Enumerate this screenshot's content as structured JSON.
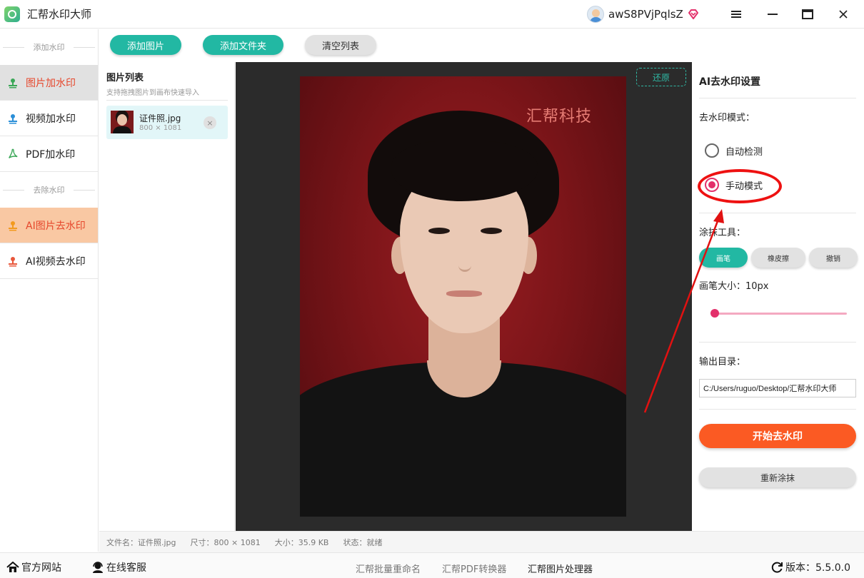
{
  "window": {
    "title": "汇帮水印大师",
    "username": "awS8PVjPqlsZ",
    "menu_icon": "hamburger-menu-icon",
    "minimize_icon": "minimize-icon",
    "maximize_icon": "maximize-icon",
    "close_icon": "close-icon"
  },
  "sidebar": {
    "section_add": "添加水印",
    "section_remove": "去除水印",
    "items": [
      {
        "label": "图片加水印",
        "icon": "image-stamp-icon",
        "active": true
      },
      {
        "label": "视频加水印",
        "icon": "video-stamp-icon",
        "active": false
      },
      {
        "label": "PDF加水印",
        "icon": "pdf-icon",
        "active": false
      },
      {
        "label": "AI图片去水印",
        "icon": "ai-image-stamp-icon",
        "active": true
      },
      {
        "label": "AI视频去水印",
        "icon": "ai-video-stamp-icon",
        "active": false
      }
    ]
  },
  "toolbar": {
    "add_image": "添加图片",
    "add_folder": "添加文件夹",
    "clear_list": "清空列表"
  },
  "image_list": {
    "title": "图片列表",
    "subtitle": "支持拖拽图片到画布快速导入",
    "files": [
      {
        "name": "证件照.jpg",
        "dims": "800 × 1081",
        "remove": "×"
      }
    ]
  },
  "canvas": {
    "restore": "还原",
    "watermark_text": "汇帮科技"
  },
  "settings": {
    "title": "AI去水印设置",
    "mode_label": "去水印模式：",
    "mode_auto": "自动检测",
    "mode_manual": "手动模式",
    "selected_mode": "手动模式",
    "tool_label": "涂抹工具：",
    "tools": [
      "画笔",
      "橡皮擦",
      "撤销"
    ],
    "selected_tool": "画笔",
    "brush_size_label": "画笔大小：",
    "brush_size_value": "10px",
    "brush_size_fraction": 0.05,
    "output_label": "输出目录：",
    "output_path": "C:/Users/ruguo/Desktop/汇帮水印大师",
    "start_button": "开始去水印",
    "reset_button": "重新涂抹"
  },
  "statusbar": {
    "filename": "文件名：证件照.jpg",
    "dimensions": "尺寸：800 × 1081",
    "size": "大小：35.9 KB",
    "status": "状态：就绪"
  },
  "footer": {
    "website": "官方网站",
    "support": "在线客服",
    "tools": [
      "汇帮批量重命名",
      "汇帮PDF转换器",
      "汇帮图片处理器"
    ],
    "version": "版本：5.5.0.0"
  },
  "colors": {
    "teal": "#22b8a3",
    "orange": "#fb5a23",
    "pink": "#e3306b",
    "annotation_red": "#e11111"
  }
}
